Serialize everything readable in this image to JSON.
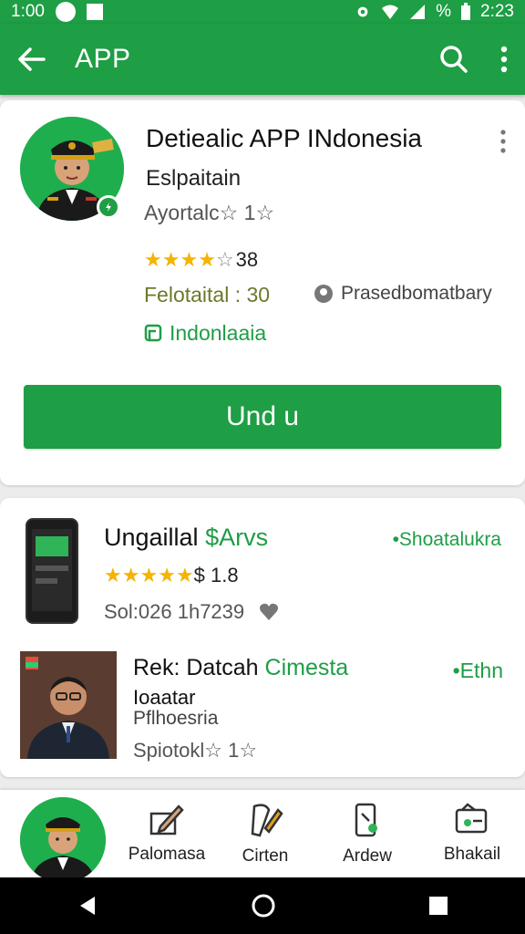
{
  "status_bar": {
    "time_left": "1:00",
    "battery": "%",
    "time_right": "2:23"
  },
  "app_bar": {
    "title": "APP"
  },
  "app_card": {
    "title": "Detiealic APP INdonesia",
    "developer": "Eslpaitain",
    "rating_text": "Ayortalc☆ 1☆",
    "score": "38",
    "feature_text": "Felotaital : 30",
    "purchase_text": "Prasedbomatbary",
    "language": "Indonlaaia",
    "install_label": "Und  u"
  },
  "items": [
    {
      "title": "Ungaillal ",
      "price": "$Arvs",
      "tag": "•Shoatalukra",
      "rating_suffix": "$ 1.8",
      "meta": "Sol:026 1h7239"
    },
    {
      "title": "Rek: Datcah ",
      "title_highlight": "Cimesta",
      "tag": "•Ethn",
      "line1": "Ioaatar",
      "line2": "Pflhoesria",
      "line3": "Spiotokl☆ 1☆"
    }
  ],
  "bottom_nav": [
    {
      "label": "Palomasa",
      "icon": "edit-icon"
    },
    {
      "label": "Cirten",
      "icon": "pen-icon"
    },
    {
      "label": "Ardew",
      "icon": "phone-icon"
    },
    {
      "label": "Bhakail",
      "icon": "wallet-icon"
    }
  ],
  "colors": {
    "accent": "#1e9e45",
    "star": "#f4b400"
  }
}
